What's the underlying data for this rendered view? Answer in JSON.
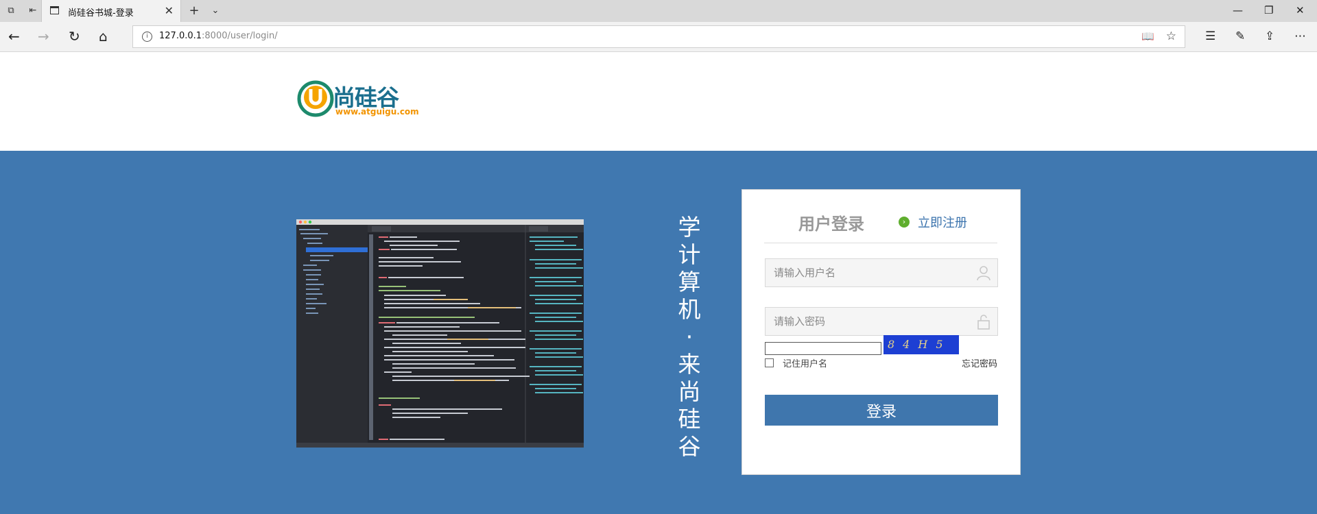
{
  "browser": {
    "tab_title": "尚硅谷书城-登录",
    "url_host": "127.0.0.1",
    "url_rest": ":8000/user/login/"
  },
  "logo": {
    "text": "尚硅谷",
    "domain": "www.atguigu.com",
    "colors": {
      "ring": "#1d8a6c",
      "u": "#f5a400",
      "text_top": "#1b6f8e",
      "text_bottom": "#f29400"
    }
  },
  "banner": {
    "background": "#4078b0",
    "slogan_chars": [
      "学",
      "计",
      "算",
      "机",
      "·",
      "来",
      "尚",
      "硅",
      "谷"
    ],
    "code_screenshot": "pycharm-flask-code-screenshot"
  },
  "login": {
    "title": "用户登录",
    "register_label": "立即注册",
    "username_placeholder": "请输入用户名",
    "password_placeholder": "请输入密码",
    "captcha_text": "84H5",
    "remember_label": "记住用户名",
    "forgot_label": "忘记密码",
    "submit_label": "登录"
  }
}
